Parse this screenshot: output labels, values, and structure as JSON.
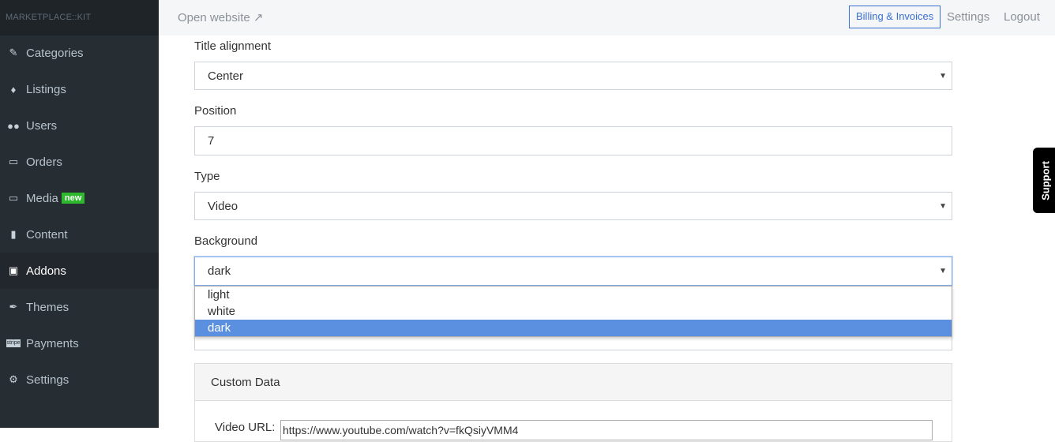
{
  "sidebar": {
    "brand": "MARKETPLACE::KIT",
    "items": [
      {
        "label": "Categories",
        "icon": "edit-icon"
      },
      {
        "label": "Listings",
        "icon": "tags-icon"
      },
      {
        "label": "Users",
        "icon": "users-icon"
      },
      {
        "label": "Orders",
        "icon": "inbox-icon"
      },
      {
        "label": "Media",
        "icon": "inbox-icon",
        "badge": "new"
      },
      {
        "label": "Content",
        "icon": "file-icon"
      },
      {
        "label": "Addons",
        "icon": "puzzle-icon",
        "active": true
      },
      {
        "label": "Themes",
        "icon": "brush-icon"
      },
      {
        "label": "Payments",
        "icon": "stripe-icon"
      },
      {
        "label": "Settings",
        "icon": "cogs-icon"
      }
    ]
  },
  "topbar": {
    "open_website": "Open website",
    "billing": "Billing & Invoices",
    "settings": "Settings",
    "logout": "Logout"
  },
  "form": {
    "title_alignment": {
      "label": "Title alignment",
      "value": "Center"
    },
    "position": {
      "label": "Position",
      "value": "7"
    },
    "type": {
      "label": "Type",
      "value": "Video"
    },
    "background": {
      "label": "Background",
      "value": "dark",
      "options": [
        "light",
        "white",
        "dark"
      ]
    }
  },
  "custom_data": {
    "title": "Custom Data",
    "video_url_label": "Video URL:",
    "video_url_value": "https://www.youtube.com/watch?v=fkQsiyVMM4"
  },
  "support": "Support",
  "colors": {
    "accent": "#3a6fd1",
    "badge": "#2db82d",
    "selected_option": "#5b8fe0",
    "sidebar": "#262d33"
  }
}
